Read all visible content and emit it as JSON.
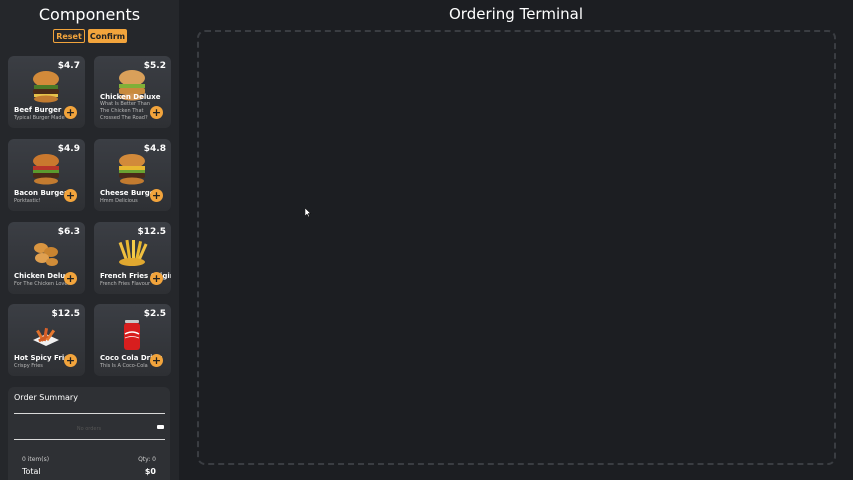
{
  "sidebar": {
    "title": "Components",
    "reset_label": "Reset",
    "confirm_label": "Confirm"
  },
  "menu": [
    {
      "name": "Beef Burger",
      "price": "$4.7",
      "desc": "Typical Burger Made",
      "icon": "beef-burger"
    },
    {
      "name": "Chicken Deluxe",
      "price": "$5.2",
      "desc": "What Is Better Than The Chicken That Crossed The Road?",
      "icon": "chicken-burger"
    },
    {
      "name": "Bacon Burger",
      "price": "$4.9",
      "desc": "Porktastic!",
      "icon": "bacon-burger"
    },
    {
      "name": "Cheese Burger",
      "price": "$4.8",
      "desc": "Hmm Delicious",
      "icon": "cheese-burger"
    },
    {
      "name": "Chicken Deluxe",
      "price": "$6.3",
      "desc": "For The Chicken Lover",
      "icon": "chicken-nuggets"
    },
    {
      "name": "French Fries Original",
      "price": "$12.5",
      "desc": "French Fries Flavour",
      "icon": "french-fries"
    },
    {
      "name": "Hot Spicy Fries",
      "price": "$12.5",
      "desc": "Crispy Fries",
      "icon": "spicy-fries"
    },
    {
      "name": "Coco Cola Drink",
      "price": "$2.5",
      "desc": "This Is A Coco-Cola",
      "icon": "cola-can"
    }
  ],
  "summary": {
    "title": "Order Summary",
    "empty_text": "No orders",
    "items_text": "0 item(s)",
    "qty_text": "Qty: 0",
    "total_label": "Total",
    "total_value": "$0"
  },
  "main": {
    "title": "Ordering Terminal"
  },
  "colors": {
    "accent": "#f2a43c",
    "background": "#1c1e22",
    "sidebar": "#25272b"
  }
}
